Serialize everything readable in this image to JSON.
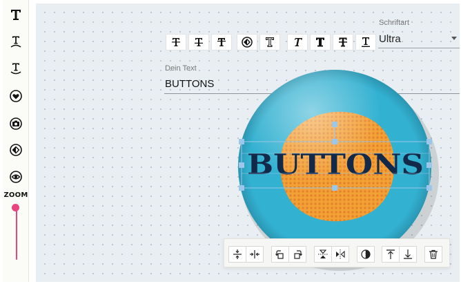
{
  "sidebar": {
    "tools": [
      {
        "icon": "text-icon"
      },
      {
        "icon": "arc-up-text-icon"
      },
      {
        "icon": "arc-down-text-icon"
      },
      {
        "icon": "heart-icon"
      },
      {
        "icon": "camera-icon"
      },
      {
        "icon": "diamond-icon"
      },
      {
        "icon": "eye-icon"
      }
    ],
    "zoom": {
      "label": "ZOOM",
      "value": 0
    }
  },
  "toolbar": {
    "groups": [
      [
        "strikethrough-text-icon",
        "strikethrough-text-alt-icon",
        "strikethrough-text-bold-icon"
      ],
      [
        "fill-shape-icon",
        "outline-text-icon"
      ],
      [
        "italic-text-icon",
        "bold-text-icon",
        "strikethrough-text-heavy-icon",
        "underline-text-icon"
      ]
    ]
  },
  "font": {
    "label": "Schriftart",
    "value": "Ultra"
  },
  "text_field": {
    "label": "Dein Text",
    "value": "BUTTONS"
  },
  "badge": {
    "text": "BUTTONS",
    "colors": {
      "base": "#33b1d1",
      "blob": "#f2a134",
      "text": "#12294a",
      "handle": "#9ac7ea"
    }
  },
  "bottom_toolbar": {
    "groups": [
      [
        "align-center-vertical-icon",
        "align-center-horizontal-icon"
      ],
      [
        "rotate-left-icon",
        "rotate-right-icon"
      ],
      [
        "flip-vertical-icon",
        "flip-horizontal-icon"
      ],
      [
        "opacity-icon"
      ],
      [
        "bring-forward-icon",
        "send-backward-icon"
      ],
      [
        "delete-icon"
      ]
    ]
  }
}
